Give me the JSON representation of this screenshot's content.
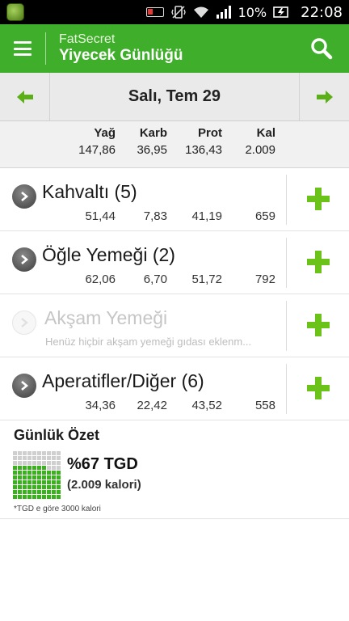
{
  "status_bar": {
    "battery_percent": "10%",
    "time": "22:08"
  },
  "app_bar": {
    "app_name": "FatSecret",
    "screen_title": "Yiyecek Günlüğü"
  },
  "date_nav": {
    "date_label": "Salı, Tem 29"
  },
  "totals": {
    "headers": [
      "Yağ",
      "Karb",
      "Prot",
      "Kal"
    ],
    "values": [
      "147,86",
      "36,95",
      "136,43",
      "2.009"
    ]
  },
  "meals": [
    {
      "title": "Kahvaltı (5)",
      "values": [
        "51,44",
        "7,83",
        "41,19",
        "659"
      ]
    },
    {
      "title": "Öğle Yemeği (2)",
      "values": [
        "62,06",
        "6,70",
        "51,72",
        "792"
      ]
    },
    {
      "title": "Akşam Yemeği",
      "subtitle": "Henüz hiçbir akşam yemeği gıdası eklenm..."
    },
    {
      "title": "Aperatifler/Diğer (6)",
      "values": [
        "34,36",
        "22,42",
        "43,52",
        "558"
      ]
    }
  ],
  "summary": {
    "title": "Günlük Özet",
    "percent_label": "%67 TGD",
    "kcal_label": "(2.009 kalori)",
    "footnote": "*TGD e göre 3000 kalori",
    "fill_fraction": 0.67
  },
  "colors": {
    "accent": "#3fae2a",
    "add_plus": "#6bc218",
    "arrow": "#5bb017"
  },
  "icons": {
    "menu": "hamburger-menu-icon",
    "search": "search-icon",
    "prev": "arrow-left-icon",
    "next": "arrow-right-icon",
    "add": "plus-icon",
    "expand": "chevron-right-icon"
  }
}
